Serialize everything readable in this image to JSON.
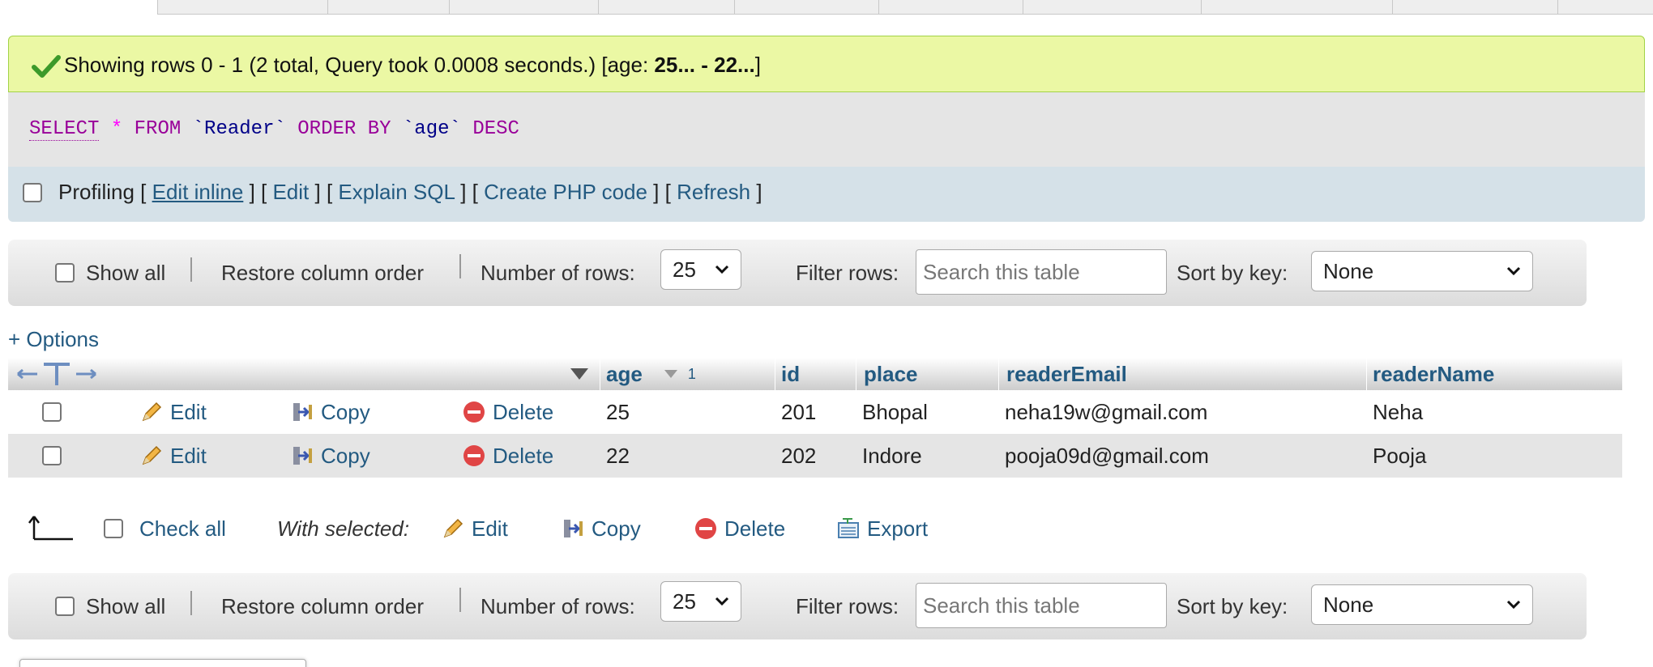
{
  "message": {
    "prefix": "Showing rows 0 - 1 (2 total, Query took 0.0008 seconds.) [age: ",
    "range": "25... - 22...",
    "suffix": "]"
  },
  "sql": {
    "select": "SELECT",
    "star": "*",
    "from": "FROM",
    "table": "`Reader`",
    "orderby": "ORDER BY",
    "column": "`age`",
    "desc": "DESC"
  },
  "profiling": {
    "label": "Profiling",
    "edit_inline": "Edit inline",
    "edit": "Edit",
    "explain": "Explain SQL",
    "php": "Create PHP code",
    "refresh": "Refresh"
  },
  "nav": {
    "show_all": "Show all",
    "restore": "Restore column order",
    "rows_label": "Number of rows:",
    "rows_value": "25",
    "filter_label": "Filter rows:",
    "search_placeholder": "Search this table",
    "sort_label": "Sort by key:",
    "sort_value": "None"
  },
  "options": "+ Options",
  "table": {
    "headers": {
      "age": "age",
      "sort_order": "1",
      "id": "id",
      "place": "place",
      "email": "readerEmail",
      "name": "readerName"
    },
    "actions": {
      "edit": "Edit",
      "copy": "Copy",
      "delete": "Delete"
    },
    "rows": [
      {
        "age": "25",
        "id": "201",
        "place": "Bhopal",
        "email": "neha19w@gmail.com",
        "name": "Neha"
      },
      {
        "age": "22",
        "id": "202",
        "place": "Indore",
        "email": "pooja09d@gmail.com",
        "name": "Pooja"
      }
    ]
  },
  "bulk": {
    "check_all": "Check all",
    "with_selected": "With selected:",
    "edit": "Edit",
    "copy": "Copy",
    "delete": "Delete",
    "export": "Export"
  },
  "colors": {
    "link": "#235a81",
    "success_bg": "#ebf8a4",
    "sql_bg": "#e5e5e5",
    "profiling_bg": "#d5e1e8"
  }
}
